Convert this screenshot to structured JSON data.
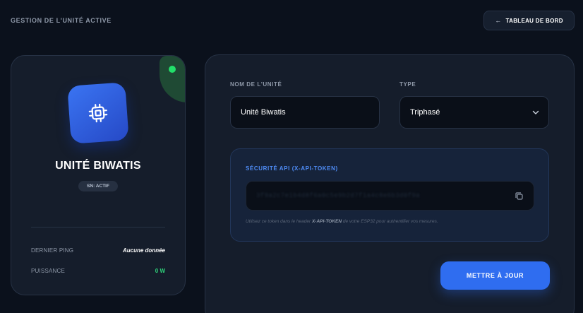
{
  "header": {
    "section_title": "GESTION DE L'UNITÉ ACTIVE",
    "back_button_label": "TABLEAU DE BORD",
    "back_arrow": "←"
  },
  "unit_card": {
    "name": "UNITÉ BIWATIS",
    "badge": "SN: ACTIF",
    "status_color": "#22e06a",
    "icon": "cpu-chip-icon",
    "stats": {
      "last_ping_label": "DERNIER PING",
      "last_ping_value": "Aucune donnée",
      "power_label": "PUISSANCE",
      "power_value": "0 W"
    }
  },
  "form": {
    "name_label": "NOM DE L'UNITÉ",
    "name_value": "Unité Biwatis",
    "type_label": "TYPE",
    "type_value": "Triphasé",
    "api": {
      "title": "SÉCURITÉ API (X-API-TOKEN)",
      "token_masked": "3f9a2c7e1b4d8f6a0c5e9b2d7f1a4c8e6b3d0f9a",
      "help_prefix": "Utilisez ce token dans le header ",
      "help_header": "X-API-TOKEN",
      "help_suffix": " de votre ESP32 pour authentifier vos mesures.",
      "copy_icon": "copy-icon"
    },
    "submit_label": "METTRE À JOUR"
  },
  "colors": {
    "background": "#0b111c",
    "card": "#151d2b",
    "accent": "#2f6df0",
    "success": "#2fd27a"
  }
}
